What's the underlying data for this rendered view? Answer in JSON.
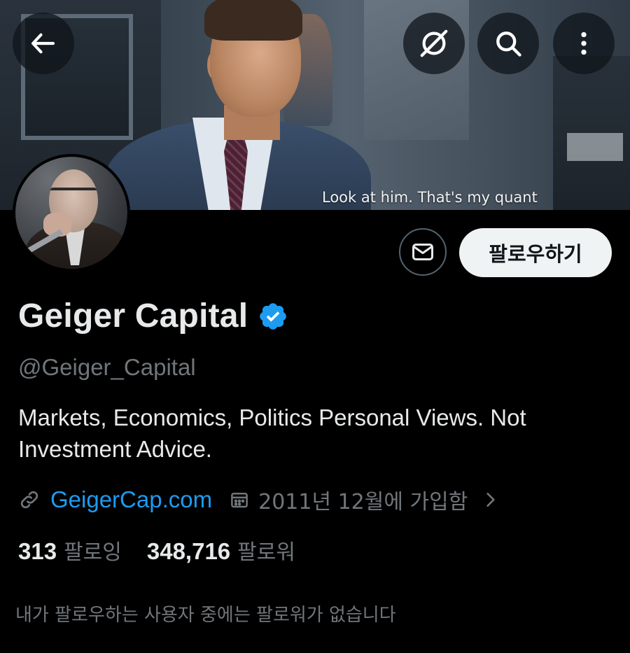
{
  "banner": {
    "caption": "Look at him. That's my quant"
  },
  "header_actions": {
    "back": "back-arrow-icon",
    "grok": "grok-icon",
    "search": "search-icon",
    "more": "more-vertical-icon"
  },
  "actions": {
    "message": "mail-icon",
    "follow_label": "팔로우하기"
  },
  "profile": {
    "name": "Geiger Capital",
    "verified_color": "#1d9bf0",
    "handle": "@Geiger_Capital",
    "bio": "Markets, Economics, Politics Personal Views. Not Investment Advice.",
    "website": "GeigerCap.com",
    "joined": "2011년 12월에 가입함"
  },
  "stats": {
    "following_count": "313",
    "following_label": "팔로잉",
    "followers_count": "348,716",
    "followers_label": "팔로워"
  },
  "mutuals_note": "내가 팔로우하는 사용자 중에는 팔로워가 없습니다",
  "colors": {
    "accent": "#1d9bf0",
    "muted": "#71767b",
    "text": "#e7e9ea",
    "background": "#000000"
  }
}
